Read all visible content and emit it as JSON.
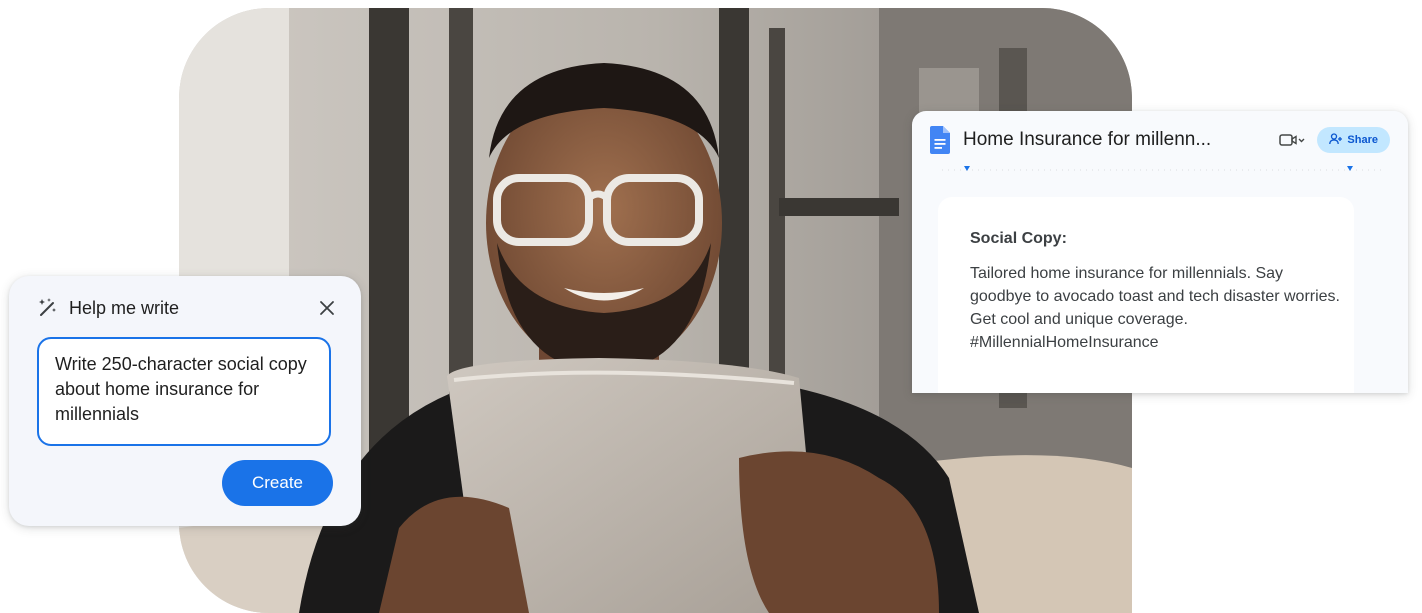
{
  "help_me_write": {
    "title": "Help me write",
    "prompt": "Write 250-character social copy about home insurance for millennials",
    "create_label": "Create"
  },
  "doc": {
    "title": "Home Insurance for millenn...",
    "share_label": "Share",
    "section_heading": "Social Copy:",
    "body": "Tailored home insurance for millennials. Say goodbye to avocado toast and tech disaster worries. Get cool and unique coverage. #MillennialHomeInsurance"
  },
  "colors": {
    "accent": "#1a73e8",
    "share_bg": "#c2e7ff",
    "docs_blue": "#4285f4"
  },
  "icons": [
    "sparkle-pen-icon",
    "close-icon",
    "docs-logo-icon",
    "meet-icon",
    "dropdown-icon",
    "person-add-icon"
  ]
}
